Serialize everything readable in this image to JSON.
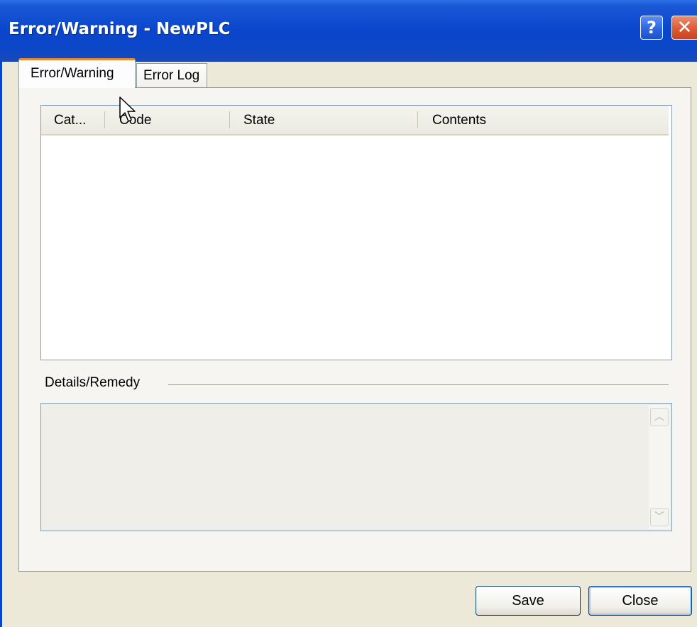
{
  "window": {
    "title": "Error/Warning - NewPLC",
    "help_label": "?",
    "close_label": "✕"
  },
  "tabs": [
    {
      "label": "Error/Warning",
      "active": true
    },
    {
      "label": "Error Log",
      "active": false
    }
  ],
  "error_list": {
    "columns": [
      "Cat...",
      "Code",
      "State",
      "Contents"
    ],
    "rows": []
  },
  "details": {
    "label": "Details/Remedy",
    "text": ""
  },
  "buttons": {
    "save": "Save",
    "close": "Close"
  },
  "colors": {
    "titlebar": "#0a46cc",
    "active_tab_accent": "#e68b2c"
  }
}
